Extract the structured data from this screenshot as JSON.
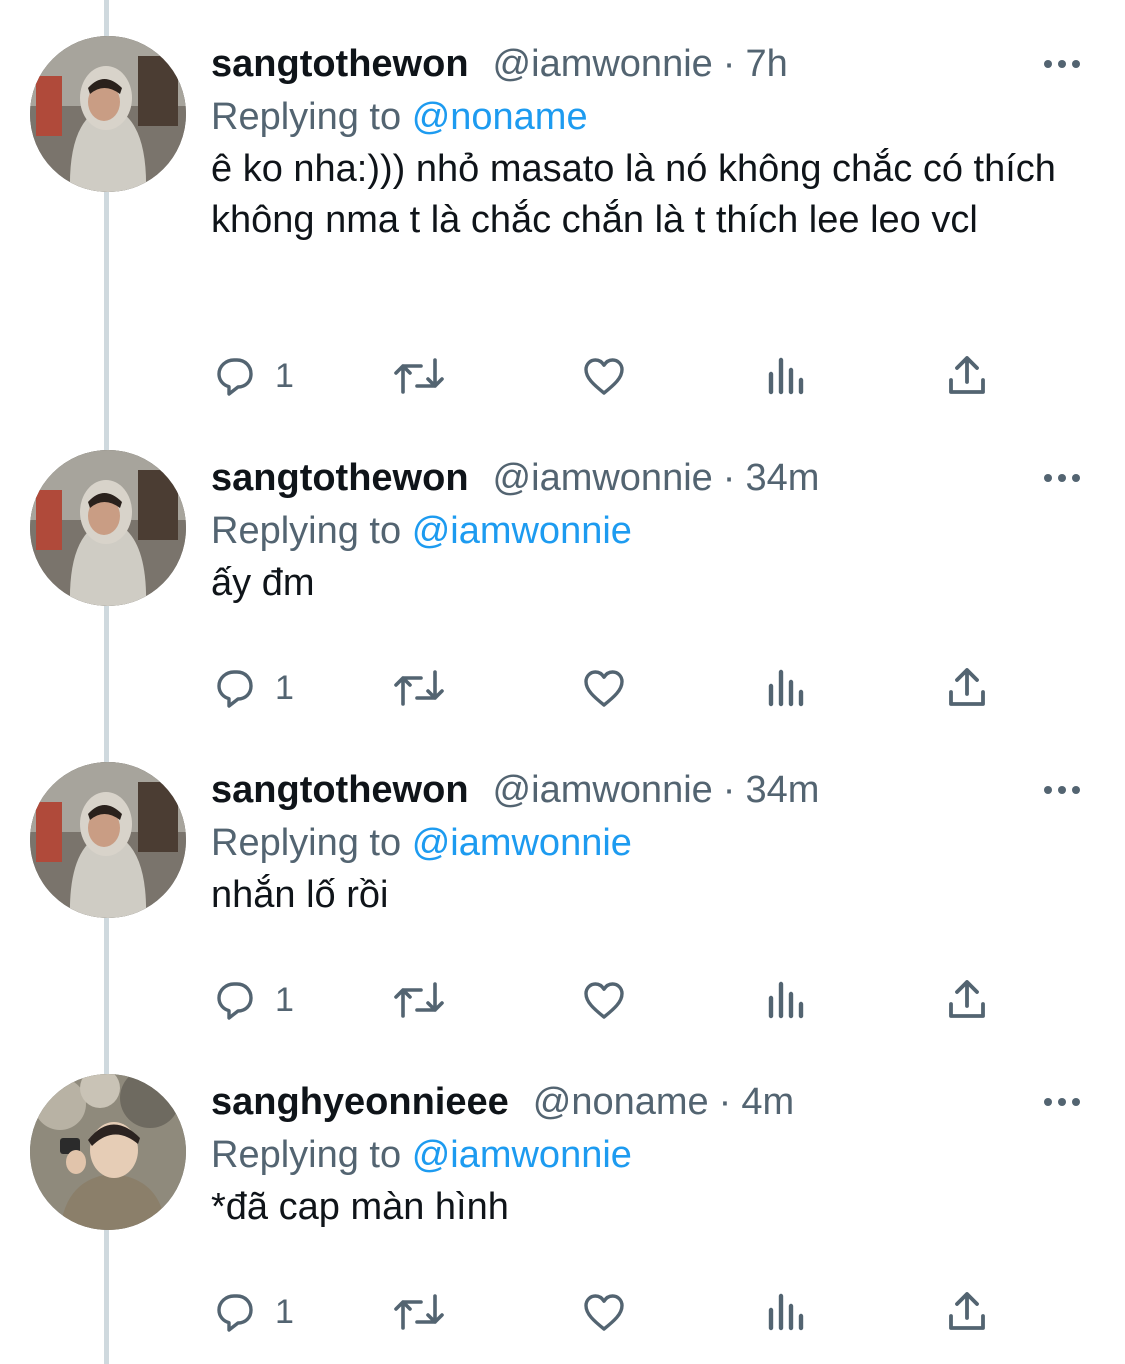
{
  "tweets": [
    {
      "name": "sangtothewon",
      "handle": "@iamwonnie",
      "separator": "·",
      "time": "7h",
      "replying_prefix": "Replying to",
      "replying_to": "@noname",
      "text": "ê ko nha:))) nhỏ masato là nó không chắc có thích không nma t là chắc chắn là t thích lee leo vcl",
      "reply_count": "1"
    },
    {
      "name": "sangtothewon",
      "handle": "@iamwonnie",
      "separator": "·",
      "time": "34m",
      "replying_prefix": "Replying to",
      "replying_to": "@iamwonnie",
      "text": "ấy đm",
      "reply_count": "1"
    },
    {
      "name": "sangtothewon",
      "handle": "@iamwonnie",
      "separator": "·",
      "time": "34m",
      "replying_prefix": "Replying to",
      "replying_to": "@iamwonnie",
      "text": "nhắn lố rồi",
      "reply_count": "1"
    },
    {
      "name": "sanghyeonnieee",
      "handle": "@noname",
      "separator": "·",
      "time": "4m",
      "replying_prefix": "Replying to",
      "replying_to": "@iamwonnie",
      "text": "*đã cap màn hình",
      "reply_count": "1"
    }
  ],
  "icons": {
    "reply": "reply-icon",
    "retweet": "retweet-icon",
    "like": "heart-icon",
    "views": "views-icon",
    "share": "share-icon",
    "more": "more-icon"
  },
  "colors": {
    "text": "#0f1419",
    "secondary": "#536471",
    "link": "#1d9bf0",
    "thread_line": "#cfd9de"
  }
}
